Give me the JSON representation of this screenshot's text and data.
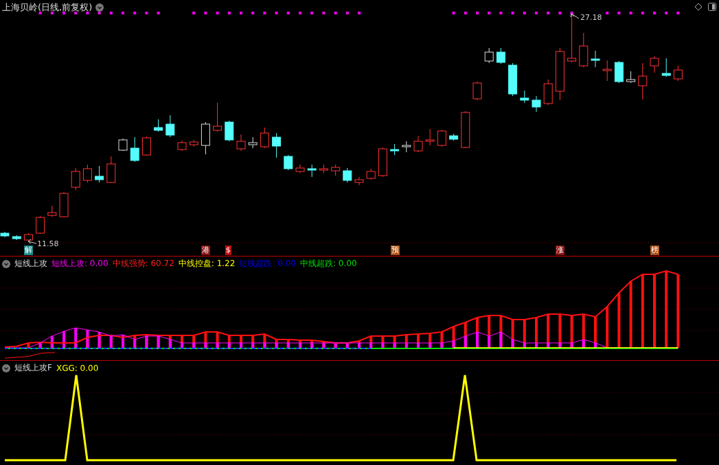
{
  "main_chart": {
    "title": "上海贝岭(日线,前复权)",
    "high_label": "27.18",
    "low_label": "11.58",
    "signals": [
      {
        "label": "解",
        "color": "#1a8a8a"
      },
      {
        "label": "港",
        "color": "#8a1010"
      },
      {
        "label": "$",
        "color": "#c01010"
      },
      {
        "label": "预",
        "color": "#b05010"
      },
      {
        "label": "涨",
        "color": "#8a1010"
      },
      {
        "label": "榜",
        "color": "#b05010"
      }
    ]
  },
  "indicator_1": {
    "name": "短线上攻",
    "values": [
      {
        "text": "短线上攻: 0.00",
        "color": "#ff00ff"
      },
      {
        "text": "中线强势: 60.72",
        "color": "#ff2020"
      },
      {
        "text": "中线控盘: 1.22",
        "color": "#ffff00"
      },
      {
        "text": "短线超跌: 0.00",
        "color": "#0000ff"
      },
      {
        "text": "中线超跌: 0.00",
        "color": "#00e000"
      }
    ]
  },
  "indicator_2": {
    "name": "短线上攻F",
    "values": [
      {
        "text": "XGG: 0.00",
        "color": "#ffff00"
      }
    ]
  }
}
